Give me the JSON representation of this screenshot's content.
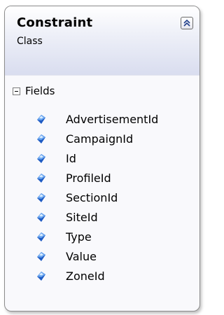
{
  "shape": {
    "title": "Constraint",
    "kind": "Class",
    "collapse_icon": "double-chevron-up-icon"
  },
  "section": {
    "label": "Fields",
    "expander_icon": "minus-box-icon"
  },
  "field_icon": "field-diamond-icon",
  "field_icon_color": "#2b6fd6",
  "fields": [
    "AdvertisementId",
    "CampaignId",
    "Id",
    "ProfileId",
    "SectionId",
    "SiteId",
    "Type",
    "Value",
    "ZoneId"
  ]
}
